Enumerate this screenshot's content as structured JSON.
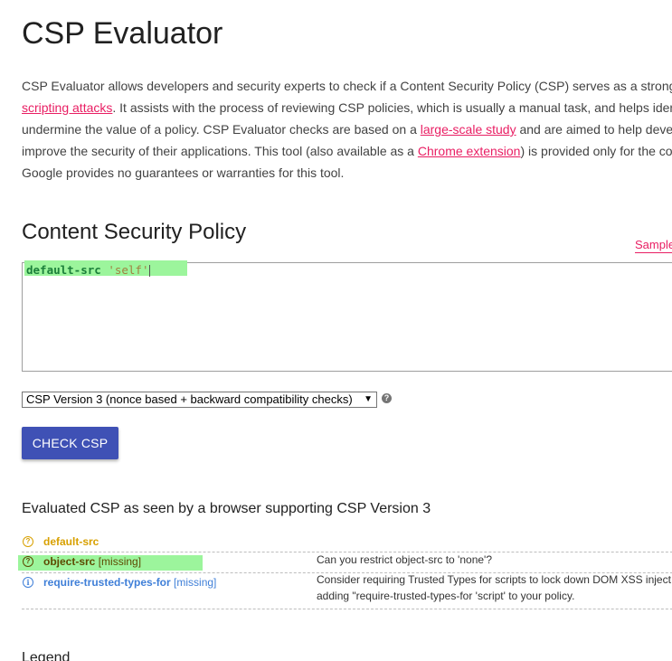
{
  "title": "CSP Evaluator",
  "intro": {
    "line1": "CSP Evaluator allows developers and security experts to check if a Content Security Policy (CSP) serves as a strong",
    "line2_link": "scripting attacks",
    "line2_rest": ". It assists with the process of reviewing CSP policies, which is usually a manual task, and helps iden",
    "line3_pre": "undermine the value of a policy. CSP Evaluator checks are based on a ",
    "line3_link": "large-scale study",
    "line3_post": " and are aimed to help deve",
    "line4_pre": "improve the security of their applications. This tool (also available as a ",
    "line4_link": "Chrome extension",
    "line4_post": ") is provided only for the co",
    "line5": "Google provides no guarantees or warranties for this tool."
  },
  "policy_section": {
    "heading": "Content Security Policy",
    "sample_link": "Sample",
    "editor": {
      "directive": "default-src",
      "value": "'self'"
    },
    "version_select": {
      "selected": "CSP Version 3 (nonce based + backward compatibility checks)",
      "arrow": "▼"
    },
    "help_icon": "?",
    "check_button": "CHECK CSP"
  },
  "results": {
    "heading": "Evaluated CSP as seen by a browser supporting CSP Version 3",
    "rows": [
      {
        "icon": "question-circle-icon",
        "icon_glyph": "?",
        "directive": "default-src",
        "missing": "",
        "description_1": "",
        "description_2": "",
        "color": "#d8a000"
      },
      {
        "icon": "question-circle-icon",
        "icon_glyph": "?",
        "directive": "object-src",
        "missing": "[missing]",
        "description_1": "Can you restrict object-src to 'none'?",
        "description_2": "",
        "color": "#5d4a00"
      },
      {
        "icon": "info-circle-icon",
        "icon_glyph": "i",
        "directive": "require-trusted-types-for",
        "missing": "[missing]",
        "description_1": "Consider requiring Trusted Types for scripts to lock down DOM XSS inject",
        "description_2": "adding \"require-trusted-types-for 'script' to your policy.",
        "color": "#3f7fd8"
      }
    ]
  },
  "legend_heading": "Legend",
  "colors": {
    "accent_button": "#3f51b5",
    "link": "#e91e63",
    "highlight": "#9cf59c"
  }
}
